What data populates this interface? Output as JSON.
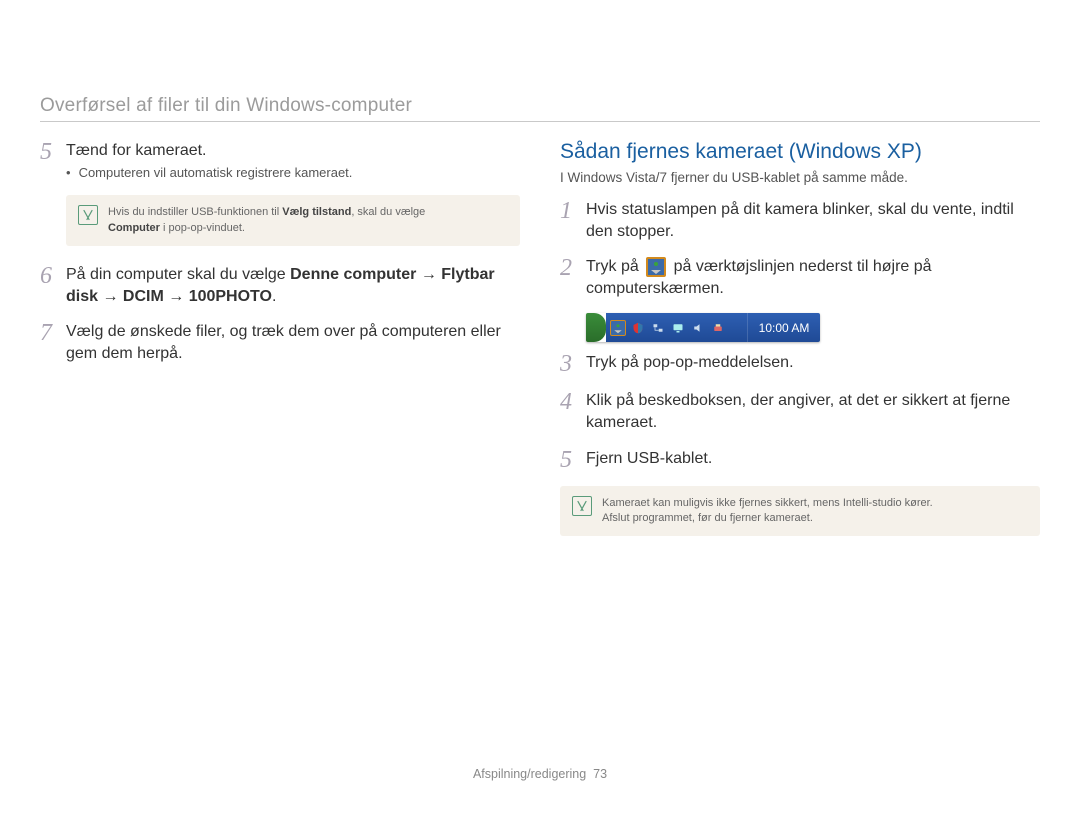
{
  "header": {
    "title": "Overførsel af filer til din Windows-computer"
  },
  "left": {
    "step5": {
      "num": "5",
      "text": "Tænd for kameraet.",
      "bullet": "Computeren vil automatisk registrere kameraet."
    },
    "note1": {
      "line_a": "Hvis du indstiller USB-funktionen til ",
      "bold_a": "Vælg tilstand",
      "line_b": ", skal du vælge ",
      "bold_b": "Computer",
      "line_c": " i pop-op-vinduet."
    },
    "step6": {
      "num": "6",
      "prefix": "På din computer skal du vælge ",
      "path_a": "Denne computer",
      "arrow": " → ",
      "path_b": "Flytbar disk",
      "path_c": "DCIM",
      "path_d": "100PHOTO",
      "suffix": "."
    },
    "step7": {
      "num": "7",
      "text": "Vælg de ønskede filer, og træk dem over på computeren eller gem dem herpå."
    }
  },
  "right": {
    "heading": "Sådan fjernes kameraet (Windows XP)",
    "intro": "I Windows Vista/7 fjerner du USB-kablet på samme måde.",
    "step1": {
      "num": "1",
      "text": "Hvis statuslampen på dit kamera blinker, skal du vente, indtil den stopper."
    },
    "step2": {
      "num": "2",
      "text_a": "Tryk på ",
      "text_b": " på værktøjslinjen nederst til højre på computerskærmen."
    },
    "taskbar_time": "10:00 AM",
    "step3": {
      "num": "3",
      "text": "Tryk på pop-op-meddelelsen."
    },
    "step4": {
      "num": "4",
      "text": "Klik på beskedboksen, der angiver, at det er sikkert at fjerne kameraet."
    },
    "step5": {
      "num": "5",
      "text": "Fjern USB-kablet."
    },
    "note2": {
      "line_a": "Kameraet kan muligvis ikke fjernes sikkert, mens Intelli-studio kører.",
      "line_b": "Afslut programmet, før du fjerner kameraet."
    }
  },
  "footer": {
    "section": "Afspilning/redigering",
    "page": "73"
  }
}
